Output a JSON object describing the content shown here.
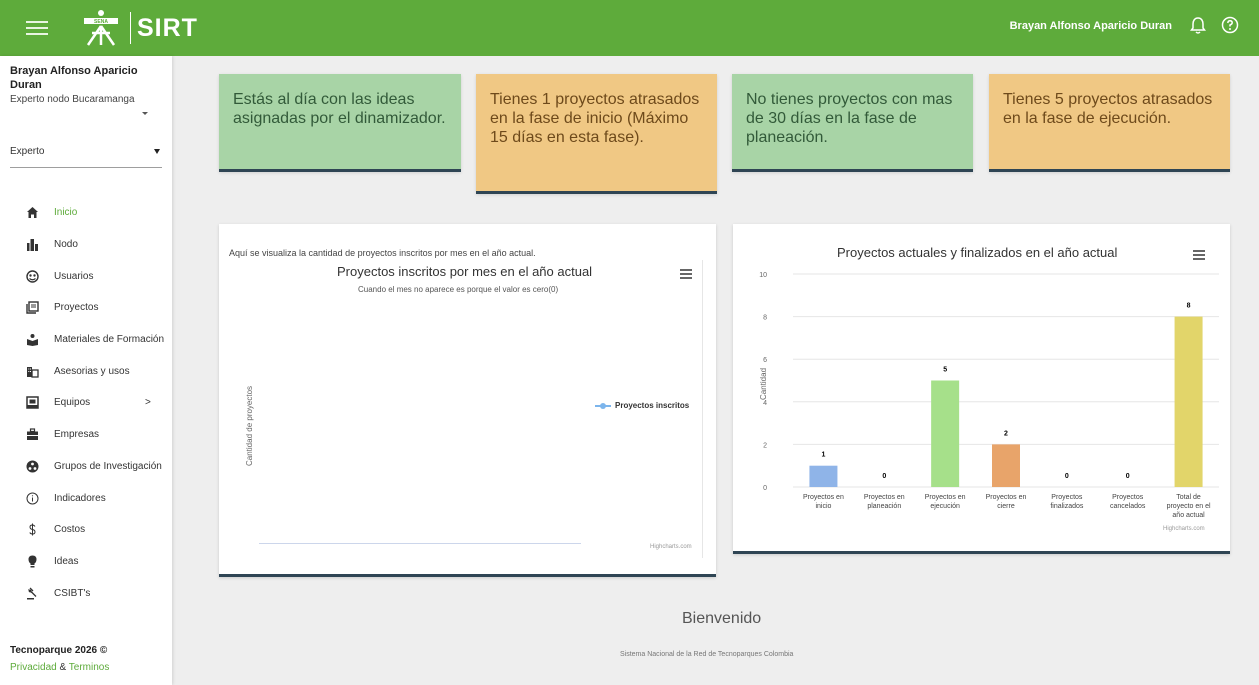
{
  "header": {
    "logo_sena": "SENA",
    "logo_sirt": "SIRT",
    "user_name": "Brayan Alfonso Aparicio Duran",
    "colors": {
      "bar": "#5eab3b"
    }
  },
  "sidebar": {
    "user_name": "Brayan Alfonso Aparicio Duran",
    "user_role": "Experto nodo Bucaramanga",
    "role_select": "Experto",
    "items": [
      {
        "label": "Inicio",
        "icon": "home-icon",
        "active": true
      },
      {
        "label": "Nodo",
        "icon": "building-icon"
      },
      {
        "label": "Usuarios",
        "icon": "users-icon"
      },
      {
        "label": "Proyectos",
        "icon": "library-icon"
      },
      {
        "label": "Materiales de Formación",
        "icon": "materials-icon"
      },
      {
        "label": "Asesorias y usos",
        "icon": "domain-icon"
      },
      {
        "label": "Equipos",
        "icon": "equipment-icon",
        "chevron": ">"
      },
      {
        "label": "Empresas",
        "icon": "business-icon"
      },
      {
        "label": "Grupos de Investigación",
        "icon": "research-icon"
      },
      {
        "label": "Indicadores",
        "icon": "info-icon"
      },
      {
        "label": "Costos",
        "icon": "dollar-icon"
      },
      {
        "label": "Ideas",
        "icon": "lightbulb-icon"
      },
      {
        "label": "CSIBT's",
        "icon": "gavel-icon"
      }
    ],
    "footer_brand": "Tecnoparque 2026 ©",
    "privacy_link": "Privacidad",
    "amp": "&",
    "terms_link": "Terminos"
  },
  "alerts": [
    {
      "text": "Estás al día con las ideas asignadas por el dinamizador.",
      "tone": "green"
    },
    {
      "text": "Tienes 1 proyectos atrasados en la fase de inicio (Máximo 15 días en esta fase).",
      "tone": "orange"
    },
    {
      "text": "No tienes proyectos con mas de 30 días en la fase de planeación.",
      "tone": "green"
    },
    {
      "text": "Tienes 5 proyectos atrasados en la fase de ejecución.",
      "tone": "orange"
    }
  ],
  "panel1": {
    "description": "Aquí se visualiza la cantidad de proyectos inscritos por mes en el año actual.",
    "credits": "Highcharts.com"
  },
  "panel2": {
    "credits": "Highcharts.com"
  },
  "chart_data": [
    {
      "type": "line",
      "title": "Proyectos inscritos por mes en el año actual",
      "subtitle": "Cuando el mes no aparece es porque el valor es cero(0)",
      "ylabel": "Cantidad de proyectos",
      "series": [
        {
          "name": "Proyectos inscritos",
          "values": [],
          "color": "#7cb5ec"
        }
      ],
      "legend": "right"
    },
    {
      "type": "bar",
      "title": "Proyectos actuales y finalizados en el año actual",
      "ylabel": "Cantidad",
      "ylim": [
        0,
        10
      ],
      "yticks": [
        0,
        2,
        4,
        6,
        8,
        10
      ],
      "grid": true,
      "categories": [
        [
          "Proyectos en",
          "inicio"
        ],
        [
          "Proyectos en",
          "planeación"
        ],
        [
          "Proyectos en",
          "ejecución"
        ],
        [
          "Proyectos en",
          "cierre"
        ],
        [
          "Proyectos",
          "finalizados"
        ],
        [
          "Proyectos",
          "cancelados"
        ],
        [
          "Total de",
          "proyecto en el",
          "año actual"
        ]
      ],
      "values": [
        1,
        0,
        5,
        2,
        0,
        0,
        8
      ],
      "colors": [
        "#8fb4e8",
        "#434348",
        "#a6e08a",
        "#e8a46a",
        "#8085e9",
        "#f15c80",
        "#e2d56a"
      ]
    }
  ],
  "footer": {
    "welcome": "Bienvenido",
    "tagline": "Sistema Nacional de la Red de Tecnoparques Colombia"
  }
}
